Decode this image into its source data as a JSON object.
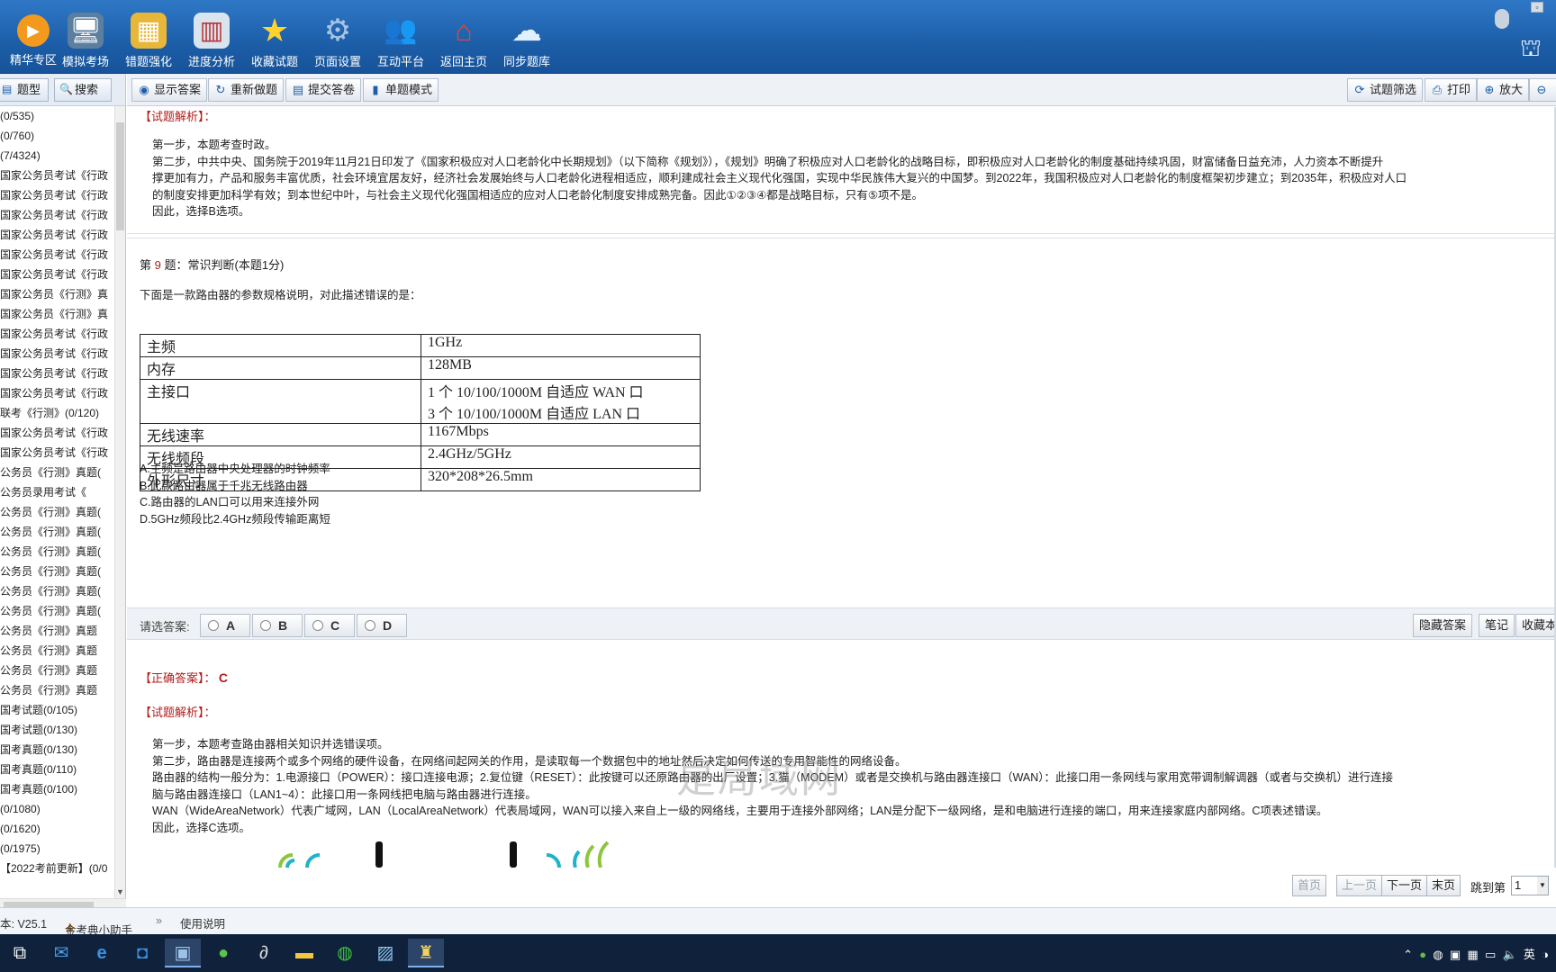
{
  "toolbar": [
    {
      "label": "精华专区",
      "icon": "play-icon"
    },
    {
      "label": "模拟考场",
      "icon": "monitor-icon"
    },
    {
      "label": "错题强化",
      "icon": "lock-icon"
    },
    {
      "label": "进度分析",
      "icon": "chart-icon"
    },
    {
      "label": "收藏试题",
      "icon": "star-icon"
    },
    {
      "label": "页面设置",
      "icon": "gear-icon"
    },
    {
      "label": "互动平台",
      "icon": "people-icon"
    },
    {
      "label": "返回主页",
      "icon": "home-icon"
    },
    {
      "label": "同步题库",
      "icon": "cloud-sync-icon"
    }
  ],
  "sidebar": {
    "tabs": [
      "题型",
      "搜索"
    ],
    "items": [
      "(0/535)",
      "(0/760)",
      "(7/4324)",
      "国家公务员考试《行政",
      "国家公务员考试《行政",
      "国家公务员考试《行政",
      "国家公务员考试《行政",
      "国家公务员考试《行政",
      "国家公务员考试《行政",
      "国家公务员《行测》真",
      "国家公务员《行测》真",
      "国家公务员考试《行政",
      "国家公务员考试《行政",
      "国家公务员考试《行政",
      "国家公务员考试《行政",
      "联考《行测》(0/120)",
      "国家公务员考试《行政",
      "国家公务员考试《行政",
      "公务员《行测》真题(",
      "公务员录用考试《",
      "公务员《行测》真题(",
      "公务员《行测》真题(",
      "公务员《行测》真题(",
      "公务员《行测》真题(",
      "公务员《行测》真题(",
      "公务员《行测》真题(",
      "公务员《行测》真题",
      "公务员《行测》真题",
      "公务员《行测》真题",
      "公务员《行测》真题",
      "国考试题(0/105)",
      "国考试题(0/130)",
      "国考真题(0/130)",
      "国考真题(0/110)",
      "国考真题(0/100)",
      "(0/1080)",
      "(0/1620)",
      "(0/1975)",
      "【2022考前更新】(0/0"
    ]
  },
  "content_toolbar": {
    "left": [
      "显示答案",
      "重新做题",
      "提交答卷",
      "单题模式"
    ],
    "right": [
      "试题筛选",
      "打印",
      "放大"
    ]
  },
  "prev_analysis": {
    "label": "【试题解析】：",
    "lines": [
      "第一步，本题考查时政。",
      "第二步，中共中央、国务院于2019年11月21日印发了《国家积极应对人口老龄化中长期规划》（以下简称《规划》），《规划》明确了积极应对人口老龄化的战略目标，即积极应对人口老龄化的制度基础持续巩固，财富储备日益充沛，人力资本不断提升",
      "撑更加有力，产品和服务丰富优质，社会环境宜居友好，经济社会发展始终与人口老龄化进程相适应，顺利建成社会主义现代化强国，实现中华民族伟大复兴的中国梦。到2022年，我国积极应对人口老龄化的制度框架初步建立；到2035年，积极应对人口",
      "的制度安排更加科学有效；到本世纪中叶，与社会主义现代化强国相适应的应对人口老龄化制度安排成熟完备。因此①②③④都是战略目标，只有⑤项不是。",
      "因此，选择B选项。"
    ]
  },
  "question": {
    "prefix": "第",
    "number": "9",
    "suffix": "题：常识判断(本题1分)",
    "stem": "下面是一款路由器的参数规格说明，对此描述错误的是：",
    "table": [
      {
        "k": "主频",
        "v": [
          "1GHz"
        ]
      },
      {
        "k": "内存",
        "v": [
          "128MB"
        ]
      },
      {
        "k": "主接口",
        "v": [
          "1 个 10/100/1000M 自适应 WAN 口",
          "3 个 10/100/1000M 自适应 LAN 口"
        ]
      },
      {
        "k": "无线速率",
        "v": [
          "1167Mbps"
        ]
      },
      {
        "k": "无线频段",
        "v": [
          "2.4GHz/5GHz"
        ]
      },
      {
        "k": "外形尺寸",
        "v": [
          "320*208*26.5mm"
        ]
      }
    ],
    "options": [
      "A.主频是路由器中央处理器的时钟频率",
      "B.此款路由器属于千兆无线路由器",
      "C.路由器的LAN口可以用来连接外网",
      "D.5GHz频段比2.4GHz频段传输距离短"
    ]
  },
  "answer_bar": {
    "prompt": "请选答案:",
    "choices": [
      "A",
      "B",
      "C",
      "D"
    ],
    "right_buttons": [
      "隐藏答案",
      "笔记",
      "收藏本"
    ]
  },
  "answer": {
    "label": "【正确答案】：",
    "value": "C",
    "analysis_label": "【试题解析】：",
    "lines": [
      "第一步，本题考查路由器相关知识并选错误项。",
      "第二步，路由器是连接两个或多个网络的硬件设备，在网络间起网关的作用，是读取每一个数据包中的地址然后决定如何传送的专用智能性的网络设备。",
      "路由器的结构一般分为：1.电源接口（POWER）：接口连接电源；2.复位键（RESET）：此按键可以还原路由器的出厂设置；3.猫（MODEM）或者是交换机与路由器连接口（WAN）：此接口用一条网线与家用宽带调制解调器（或者与交换机）进行连接",
      "脑与路由器连接口（LAN1~4）：此接口用一条网线把电脑与路由器进行连接。",
      "WAN（WideAreaNetwork）代表广域网，LAN（LocalAreaNetwork）代表局域网，WAN可以接入来自上一级的网络线，主要用于连接外部网络；LAN是分配下一级网络，是和电脑进行连接的端口，用来连接家庭内部网络。C项表述错误。",
      "因此，选择C选项。"
    ],
    "watermark": "是局域网"
  },
  "pager": {
    "first": "首页",
    "prev": "上一页",
    "next": "下一页",
    "last": "末页",
    "jump_label": "跳到第",
    "jump_value": "1"
  },
  "statusbar": {
    "version": "本: V25.1",
    "assistant": "金考典小助手",
    "guide": "使用说明"
  },
  "taskbar": {
    "ime": "英",
    "icons": [
      "task-view-icon",
      "mail-icon",
      "edge-icon",
      "store-icon",
      "photo-app-icon",
      "browser-icon",
      "app-icon",
      "folder-icon",
      "wechat-icon",
      "image-viewer-icon",
      "exam-app-icon"
    ]
  },
  "colors": {
    "toolbar_blue": "#1c5ea8",
    "label_red": "#b21d1d"
  }
}
